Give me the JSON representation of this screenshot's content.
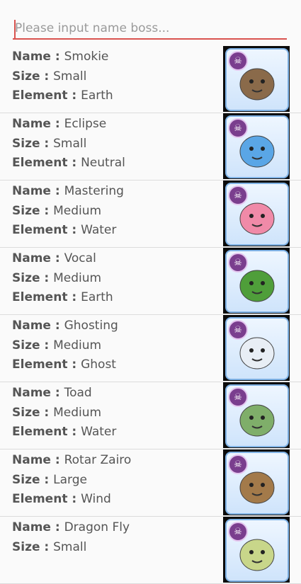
{
  "search": {
    "placeholder": "Please input name boss...",
    "value": ""
  },
  "labels": {
    "name": "Name",
    "size": "Size",
    "element": "Element",
    "separator": " : "
  },
  "colors": {
    "accent": "#d9534f",
    "divider": "#dcdcdc",
    "thumb_border": "#7fb2e5",
    "badge": "#7a3e8e"
  },
  "bosses": [
    {
      "name": "Smokie",
      "size": "Small",
      "element": "Earth",
      "icon": "raccoon-monster-icon",
      "color": "#8a6a4a"
    },
    {
      "name": "Eclipse",
      "size": "Small",
      "element": "Neutral",
      "icon": "blue-rabbit-monster-icon",
      "color": "#5aa6e6"
    },
    {
      "name": "Mastering",
      "size": "Medium",
      "element": "Water",
      "icon": "pink-poring-monster-icon",
      "color": "#f08aa8"
    },
    {
      "name": "Vocal",
      "size": "Medium",
      "element": "Earth",
      "icon": "green-cricket-monster-icon",
      "color": "#4f9e3a"
    },
    {
      "name": "Ghosting",
      "size": "Medium",
      "element": "Ghost",
      "icon": "white-ghost-monster-icon",
      "color": "#e8eef5"
    },
    {
      "name": "Toad",
      "size": "Medium",
      "element": "Water",
      "icon": "green-toad-monster-icon",
      "color": "#7fae6a"
    },
    {
      "name": "Rotar Zairo",
      "size": "Large",
      "element": "Wind",
      "icon": "rotar-zairo-monster-icon",
      "color": "#a37a4a"
    },
    {
      "name": "Dragon Fly",
      "size": "Small",
      "element": "",
      "icon": "dragon-fly-monster-icon",
      "color": "#c8d68a"
    }
  ]
}
